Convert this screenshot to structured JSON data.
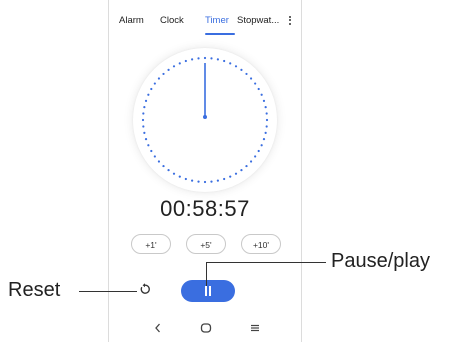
{
  "tabs": [
    {
      "label": "Alarm",
      "active": false
    },
    {
      "label": "Clock",
      "active": false
    },
    {
      "label": "Timer",
      "active": true
    },
    {
      "label": "Stopwat...",
      "active": false
    }
  ],
  "timer": {
    "display": "00:58:57"
  },
  "add_buttons": [
    "+1'",
    "+5'",
    "+10'"
  ],
  "annotations": {
    "reset": "Reset",
    "pause_play": "Pause/play"
  },
  "colors": {
    "accent": "#3a6ee0",
    "text": "#222222"
  },
  "icons": [
    "more-vert-icon",
    "reset-icon",
    "pause-icon",
    "back-icon",
    "home-icon",
    "recents-icon"
  ]
}
